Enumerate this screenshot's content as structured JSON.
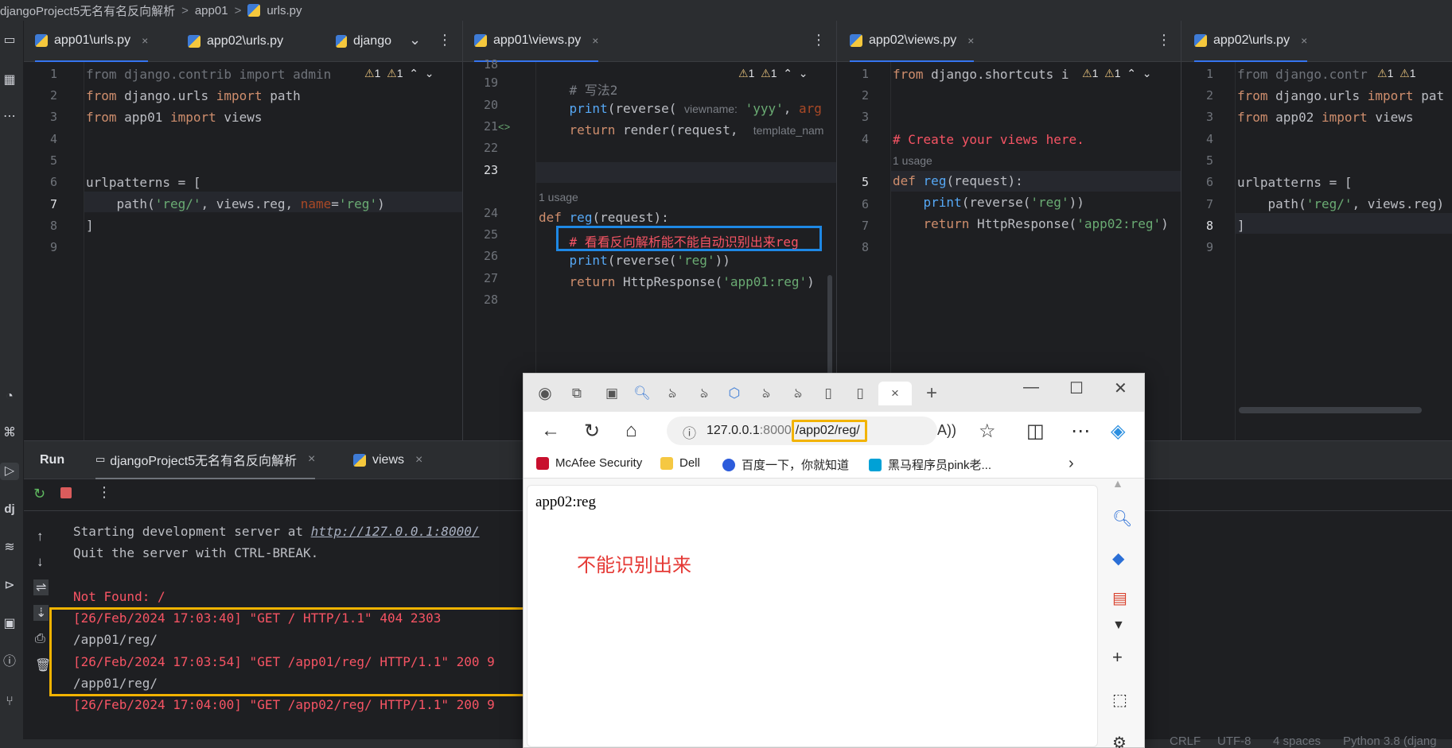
{
  "breadcrumb": {
    "project": "djangoProject5无名有名反向解析",
    "folder": "app01",
    "file": "urls.py",
    "separator": ">"
  },
  "panes": [
    {
      "tabs": [
        {
          "label": "app01\\urls.py",
          "close": "×"
        },
        {
          "label": "app02\\urls.py"
        },
        {
          "label": "django"
        }
      ],
      "more_tabs": "⌄",
      "warnings": {
        "a": "1",
        "b": "1"
      },
      "lines": [
        "1",
        "2",
        "3",
        "4",
        "5",
        "6",
        "7",
        "8",
        "9"
      ]
    },
    {
      "tabs": [
        {
          "label": "app01\\views.py",
          "close": "×"
        }
      ],
      "warnings": {
        "a": "1",
        "b": "1"
      },
      "lines": [
        "18",
        "19",
        "20",
        "21",
        "22",
        "23",
        "24",
        "25",
        "26",
        "27",
        "28"
      ],
      "usage": "1 usage",
      "hints": {
        "viewname": "viewname:",
        "template": "template_nam",
        "arg": "arg"
      }
    },
    {
      "tabs": [
        {
          "label": "app02\\views.py",
          "close": "×"
        }
      ],
      "warnings": {
        "a": "1",
        "b": "1"
      },
      "lines": [
        "1",
        "2",
        "3",
        "4",
        "5",
        "6",
        "7",
        "8"
      ],
      "usage": "1 usage"
    },
    {
      "tabs": [
        {
          "label": "app02\\urls.py",
          "close": "×"
        }
      ],
      "warnings": {
        "a": "1",
        "b": "1"
      },
      "lines": [
        "1",
        "2",
        "3",
        "4",
        "5",
        "6",
        "7",
        "8",
        "9"
      ]
    }
  ],
  "run": {
    "title": "Run",
    "tabs": [
      {
        "label": "djangoProject5无名有名反向解析",
        "close": "×"
      },
      {
        "label": "views",
        "close": "×"
      }
    ],
    "console": {
      "start_prefix": "Starting development server at ",
      "start_url": "http://127.0.0.1:8000/",
      "quit": "Quit the server with CTRL-BREAK.",
      "not_found": "Not Found: /",
      "log1": "[26/Feb/2024 17:03:40] \"GET / HTTP/1.1\" 404 2303",
      "path1": "/app01/reg/",
      "log2": "[26/Feb/2024 17:03:54] \"GET /app01/reg/ HTTP/1.1\" 200 9",
      "path2": "/app01/reg/",
      "log3": "[26/Feb/2024 17:04:00] \"GET /app02/reg/ HTTP/1.1\" 200 9"
    }
  },
  "status_bar": {
    "line_sep": "CRLF",
    "encoding": "UTF-8",
    "indent": "4 spaces",
    "interpreter": "Python 3.8 (djang"
  },
  "browser": {
    "address": {
      "host": "127.0.0.1",
      "port": ":8000",
      "path": "/app02/reg/"
    },
    "bookmarks": [
      {
        "label": "McAfee Security"
      },
      {
        "label": "Dell"
      },
      {
        "label": "百度一下，你就知道"
      },
      {
        "label": "黑马程序员pink老..."
      }
    ],
    "page_text": "app02:reg",
    "annotation": "不能识别出来",
    "tab_close": "×",
    "new_tab": "+"
  },
  "colors": {
    "accent_blue": "#3574f0",
    "highlight_yellow": "#f2b300",
    "highlight_blue": "#1e88e5",
    "console_red": "#f75464"
  }
}
